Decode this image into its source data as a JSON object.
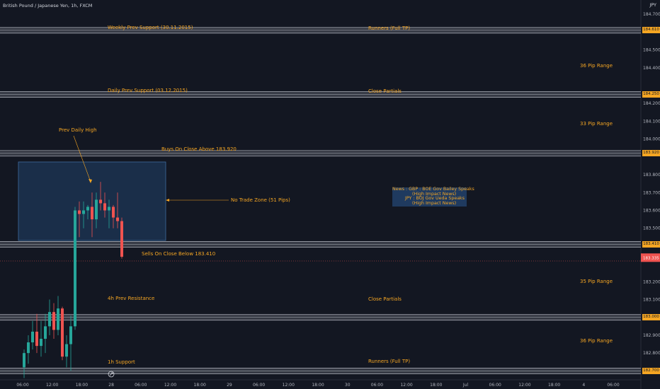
{
  "header": {
    "symbol": "British Pound / Japanese Yen, 1h, FXCM",
    "currency": "JPY"
  },
  "colors": {
    "up": "#26a69a",
    "down": "#ef5350",
    "annotation": "#f5a623",
    "zone": "#1f3a5f",
    "level_band": "#787b86",
    "background": "#131722"
  },
  "chart_data": {
    "type": "candlestick",
    "ylim": [
      182.65,
      184.78
    ],
    "y_ticks": [
      {
        "value": 184.7,
        "label": "184.700"
      },
      {
        "value": 184.5,
        "label": "184.500"
      },
      {
        "value": 184.4,
        "label": "184.400"
      },
      {
        "value": 184.2,
        "label": "184.200"
      },
      {
        "value": 184.1,
        "label": "184.100"
      },
      {
        "value": 184.0,
        "label": "184.000"
      },
      {
        "value": 183.8,
        "label": "183.800"
      },
      {
        "value": 183.7,
        "label": "183.700"
      },
      {
        "value": 183.6,
        "label": "183.600"
      },
      {
        "value": 183.5,
        "label": "183.500"
      },
      {
        "value": 183.2,
        "label": "183.200"
      },
      {
        "value": 183.1,
        "label": "183.100"
      },
      {
        "value": 182.9,
        "label": "182.900"
      },
      {
        "value": 182.8,
        "label": "182.800"
      }
    ],
    "x_ticks": [
      "06:00",
      "12:00",
      "18:00",
      "28",
      "06:00",
      "12:00",
      "18:00",
      "29",
      "06:00",
      "12:00",
      "18:00",
      "30",
      "06:00",
      "12:00",
      "18:00",
      "Jul",
      "06:00",
      "12:00",
      "18:00",
      "4",
      "06:00"
    ],
    "price_levels": [
      {
        "price": 184.61,
        "label": "184.610"
      },
      {
        "price": 184.25,
        "label": "184.250"
      },
      {
        "price": 183.92,
        "label": "183.920"
      },
      {
        "price": 183.41,
        "label": "183.410"
      },
      {
        "price": 183.0,
        "label": "183.000"
      },
      {
        "price": 182.7,
        "label": "182.700"
      }
    ],
    "current_price": {
      "price": 183.335,
      "label": "183.335"
    },
    "candles": [
      {
        "o": 182.72,
        "h": 182.82,
        "l": 182.66,
        "c": 182.8
      },
      {
        "o": 182.8,
        "h": 182.9,
        "l": 182.74,
        "c": 182.86
      },
      {
        "o": 182.86,
        "h": 182.98,
        "l": 182.82,
        "c": 182.92
      },
      {
        "o": 182.92,
        "h": 183.02,
        "l": 182.8,
        "c": 182.84
      },
      {
        "o": 182.84,
        "h": 182.98,
        "l": 182.78,
        "c": 182.88
      },
      {
        "o": 182.88,
        "h": 183.02,
        "l": 182.8,
        "c": 182.95
      },
      {
        "o": 182.95,
        "h": 183.1,
        "l": 182.9,
        "c": 183.03
      },
      {
        "o": 183.03,
        "h": 183.08,
        "l": 182.88,
        "c": 182.93
      },
      {
        "o": 182.93,
        "h": 183.12,
        "l": 182.9,
        "c": 183.05
      },
      {
        "o": 183.05,
        "h": 183.06,
        "l": 182.76,
        "c": 182.78
      },
      {
        "o": 182.78,
        "h": 182.9,
        "l": 182.72,
        "c": 182.85
      },
      {
        "o": 182.85,
        "h": 183.01,
        "l": 182.7,
        "c": 182.95
      },
      {
        "o": 182.95,
        "h": 183.62,
        "l": 182.93,
        "c": 183.6
      },
      {
        "o": 183.6,
        "h": 183.65,
        "l": 183.45,
        "c": 183.58
      },
      {
        "o": 183.58,
        "h": 183.65,
        "l": 183.5,
        "c": 183.6
      },
      {
        "o": 183.6,
        "h": 183.63,
        "l": 183.55,
        "c": 183.62
      },
      {
        "o": 183.62,
        "h": 183.7,
        "l": 183.45,
        "c": 183.55
      },
      {
        "o": 183.55,
        "h": 183.7,
        "l": 183.5,
        "c": 183.66
      },
      {
        "o": 183.66,
        "h": 183.76,
        "l": 183.6,
        "c": 183.64
      },
      {
        "o": 183.64,
        "h": 183.7,
        "l": 183.56,
        "c": 183.6
      },
      {
        "o": 183.6,
        "h": 183.66,
        "l": 183.5,
        "c": 183.62
      },
      {
        "o": 183.62,
        "h": 183.63,
        "l": 183.5,
        "c": 183.56
      },
      {
        "o": 183.56,
        "h": 183.7,
        "l": 183.5,
        "c": 183.54
      },
      {
        "o": 183.54,
        "h": 183.56,
        "l": 183.33,
        "c": 183.34
      }
    ]
  },
  "annotations": {
    "weekly_support": "Weekly Prev Support (30.11.2015)",
    "runners_top": "Runners (Full TP)",
    "range_36_top": "36 Pip Range",
    "daily_support": "Daily Prev Support (03.12.2015)",
    "close_partials_top": "Close Partials",
    "range_33": "33 Pip Range",
    "prev_daily_high": "Prev Daily High",
    "buys": "Buys On Close Above 183.920",
    "no_trade": "No Trade Zone (51 Pips)",
    "sells": "Sells On Close Below 183.410",
    "range_35": "35 Pip Range",
    "resistance_4h": "4h Prev Resistance",
    "close_partials_bottom": "Close Partials",
    "range_36_bottom": "36 Pip Range",
    "support_1h": "1h Support",
    "runners_bottom": "Runners (Full TP)"
  },
  "news": {
    "line1": "News : GBP : BOE Gov Bailey Speaks",
    "line2": "              (High Impact News)",
    "line3": "         JPY : BOJ Gov Ueda Speaks",
    "line4": "              (High Impact News)"
  }
}
